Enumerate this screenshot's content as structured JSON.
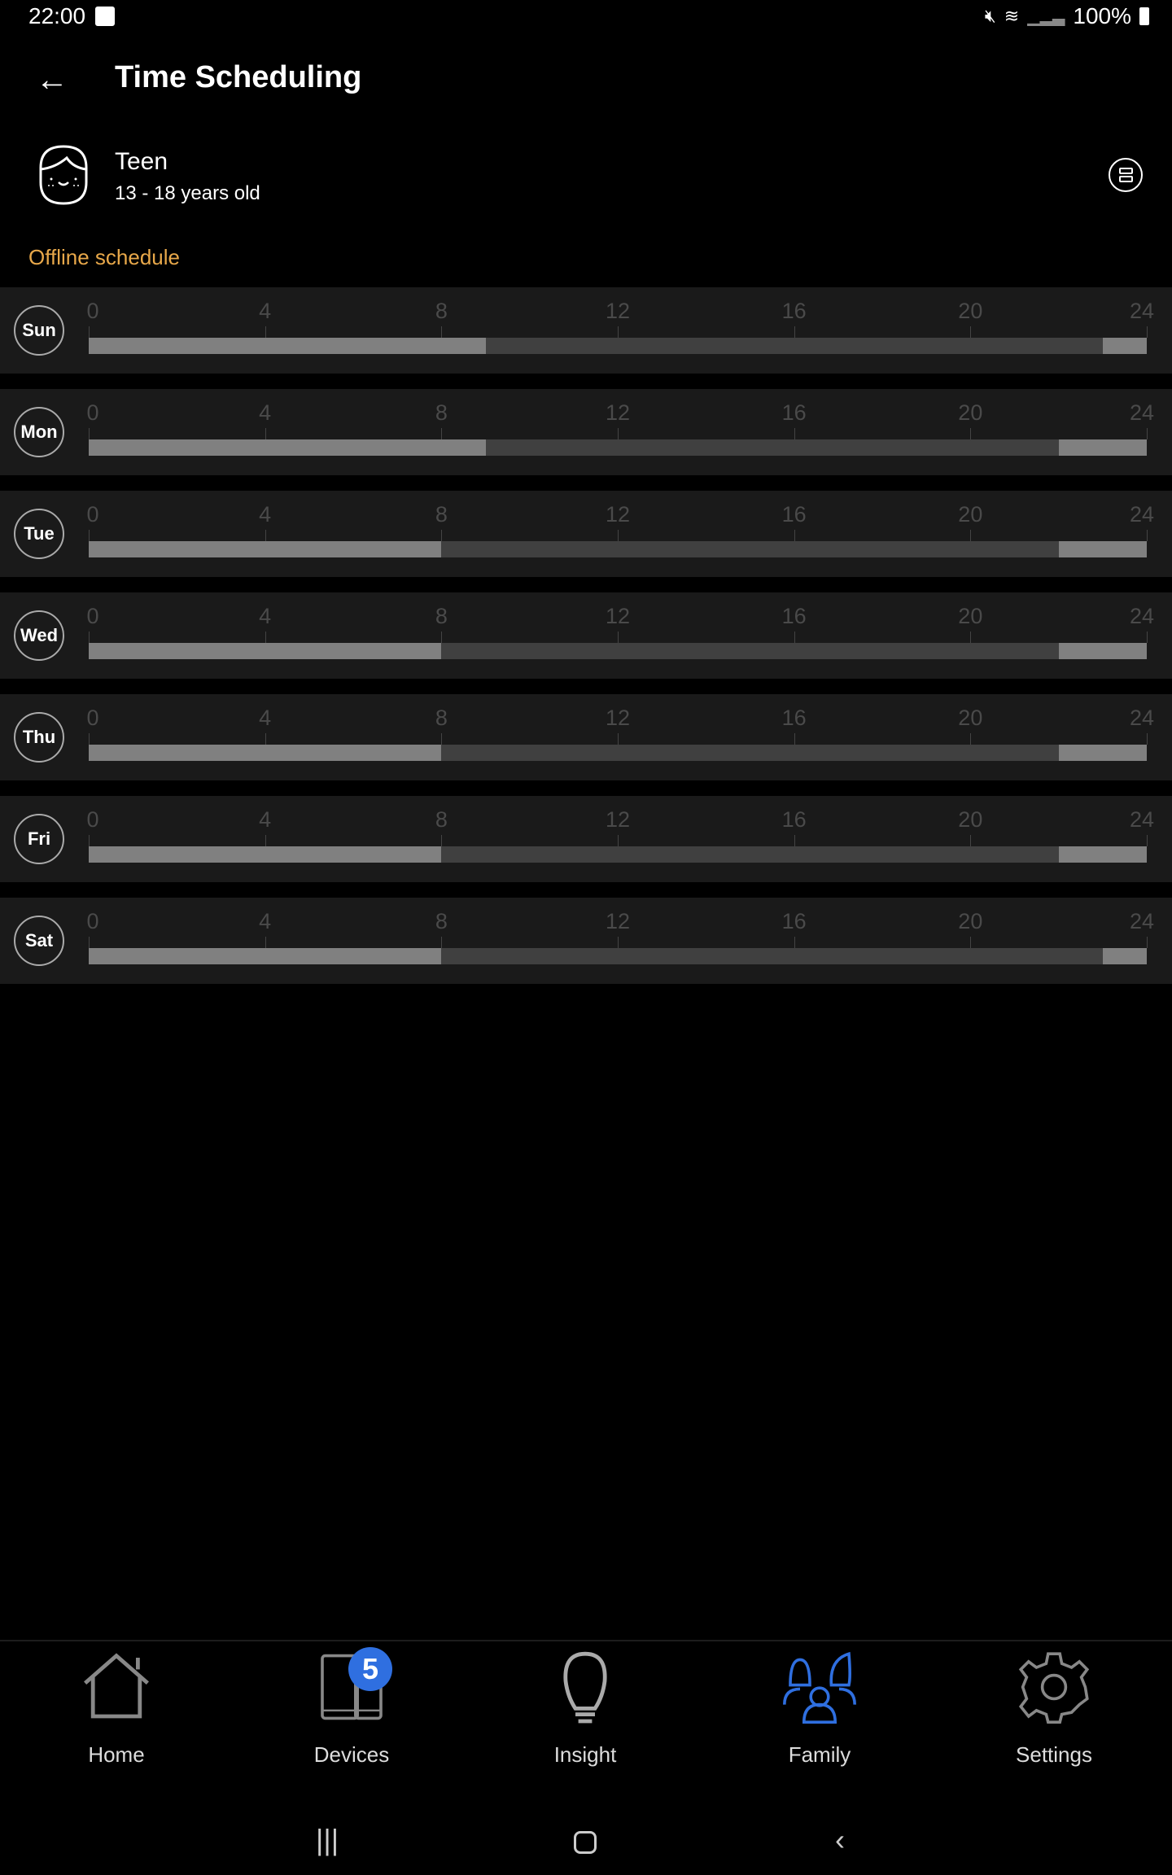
{
  "status_bar": {
    "time": "22:00",
    "battery": "100%"
  },
  "header": {
    "title": "Time Scheduling"
  },
  "profile": {
    "name": "Teen",
    "age_range": "13 - 18 years old"
  },
  "section_title": "Offline schedule",
  "axis_ticks": [
    "0",
    "4",
    "8",
    "12",
    "16",
    "20",
    "24"
  ],
  "colors": {
    "accent": "#e8a84a",
    "active_nav": "#2f6fe0",
    "offline_block": "#808080",
    "online_block": "#404040"
  },
  "schedule": [
    {
      "day": "Sun",
      "offline_hours": [
        [
          0,
          9
        ],
        [
          23,
          24
        ]
      ]
    },
    {
      "day": "Mon",
      "offline_hours": [
        [
          0,
          9
        ],
        [
          22,
          24
        ]
      ]
    },
    {
      "day": "Tue",
      "offline_hours": [
        [
          0,
          8
        ],
        [
          22,
          24
        ]
      ]
    },
    {
      "day": "Wed",
      "offline_hours": [
        [
          0,
          8
        ],
        [
          22,
          24
        ]
      ]
    },
    {
      "day": "Thu",
      "offline_hours": [
        [
          0,
          8
        ],
        [
          22,
          24
        ]
      ]
    },
    {
      "day": "Fri",
      "offline_hours": [
        [
          0,
          8
        ],
        [
          22,
          24
        ]
      ]
    },
    {
      "day": "Sat",
      "offline_hours": [
        [
          0,
          8
        ],
        [
          23,
          24
        ]
      ]
    }
  ],
  "nav": {
    "items": [
      {
        "label": "Home",
        "icon": "home-icon"
      },
      {
        "label": "Devices",
        "icon": "devices-icon",
        "badge": "5"
      },
      {
        "label": "Insight",
        "icon": "lightbulb-icon"
      },
      {
        "label": "Family",
        "icon": "family-icon",
        "active": true
      },
      {
        "label": "Settings",
        "icon": "gear-icon"
      }
    ]
  }
}
